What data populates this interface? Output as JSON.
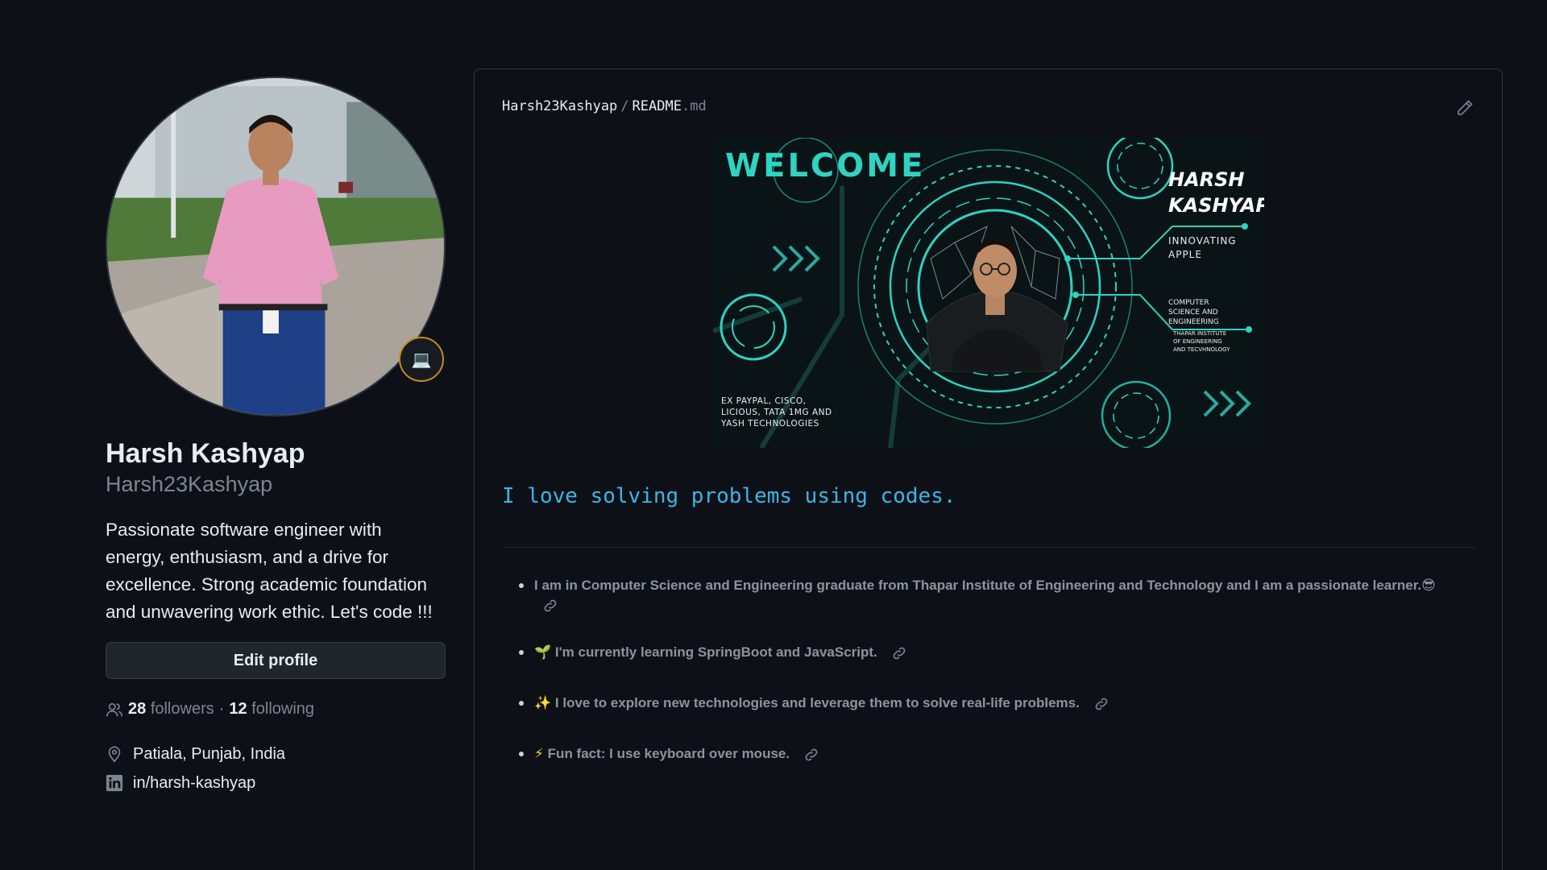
{
  "profile": {
    "name": "Harsh Kashyap",
    "login": "Harsh23Kashyap",
    "bio": "Passionate software engineer with energy, enthusiasm, and a drive for excellence. Strong academic foundation and unwavering work ethic. Let's code !!!",
    "edit_label": "Edit profile",
    "followers_count": "28",
    "followers_label": "followers",
    "separator": "·",
    "following_count": "12",
    "following_label": "following",
    "location": "Patiala, Punjab, India",
    "linkedin": "in/harsh-kashyap",
    "status_emoji": "💻"
  },
  "readme": {
    "owner": "Harsh23Kashyap",
    "path_sep": "/",
    "file": "README",
    "ext": ".md",
    "banner": {
      "welcome": "WELCOME",
      "name_line1": "HARSH",
      "name_line2": "KASHYAP",
      "role_line1": "INNOVATING",
      "role_line2": "APPLE",
      "edu_line1": "COMPUTER",
      "edu_line2": "SCIENCE AND",
      "edu_line3": "ENGINEERING",
      "inst_line1": "THAPAR INSTITUTE",
      "inst_line2": "OF ENGINEERING",
      "inst_line3": "AND TECVHNOLOGY",
      "exp_line1": "EX PAYPAL, CISCO,",
      "exp_line2": "LICIOUS, TATA 1MG AND",
      "exp_line3": "YASH TECHNOLOGIES"
    },
    "tagline": "I love solving problems using codes.",
    "bullets": [
      {
        "emoji": "",
        "text": "I am in Computer Science and Engineering graduate from Thapar Institute of Engineering and Technology and I am a passionate learner.",
        "trail": "😎"
      },
      {
        "emoji": "🌱",
        "text": "I'm currently learning SpringBoot and JavaScript.",
        "trail": ""
      },
      {
        "emoji": "✨",
        "text": "I love to explore new technologies and leverage them to solve real-life problems.",
        "trail": ""
      },
      {
        "emoji": "⚡",
        "text": "Fun fact: I use keyboard over mouse.",
        "trail": ""
      }
    ]
  },
  "colors": {
    "background": "#0d1117",
    "border": "#30363d",
    "muted": "#7d8590",
    "accent_blue": "#3cb4e6",
    "banner_teal": "#2fd3c0",
    "badge_ring": "#c78a1d"
  }
}
